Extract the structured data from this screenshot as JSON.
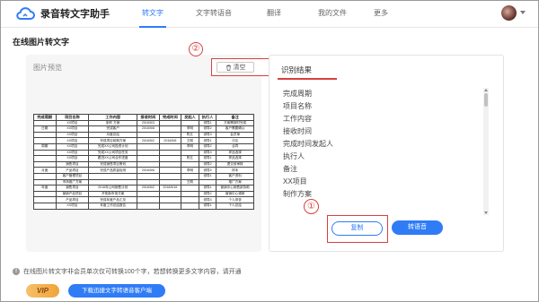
{
  "app": {
    "title": "录音转文字助手"
  },
  "nav": {
    "items": [
      {
        "label": "转文字",
        "active": true
      },
      {
        "label": "文字转语音",
        "active": false
      },
      {
        "label": "翻译",
        "active": false
      },
      {
        "label": "我的文件",
        "active": false
      },
      {
        "label": "更多",
        "active": false
      }
    ]
  },
  "page": {
    "title": "在线图片转文字"
  },
  "preview": {
    "label": "图片预览",
    "clear_label": "清空",
    "marker": "②",
    "document": {
      "headers": [
        "完成周期",
        "项目名称",
        "工作内容",
        "接收时间",
        "完成时间",
        "发起人",
        "执行人",
        "备注"
      ],
      "rows": [
        [
          "",
          "XX项目",
          "制作 方案",
          "2016/5/3",
          "",
          "",
          "领导1",
          "方案需按时完成"
        ],
        [
          "日期",
          "XX项目",
          "完成客户",
          "2016/5/8",
          "",
          "李明",
          "领导2",
          "客户需要确认"
        ],
        [
          "",
          "XX项目",
          "月度总结",
          "",
          "",
          "陈五",
          "领导3",
          "会员单"
        ],
        [
          "",
          "XX项目",
          "完成项目前期方案",
          "2016/5/2",
          "2016/5/6",
          "王刚",
          "领导1",
          "讨论"
        ],
        [
          "周期",
          "XX项目",
          "完成XX公司投资计划",
          "",
          "",
          "李明",
          "领导2",
          "合同"
        ],
        [
          "",
          "XX项目",
          "完成XX公司项目任务",
          "",
          "",
          "",
          "领导3",
          "样品选择"
        ],
        [
          "",
          "XX项目",
          "跟进XX公司合作进度",
          "",
          "",
          "陈五",
          "领导1",
          "样品选择"
        ],
        [
          "",
          "销售项目",
          "完成销售项目策划",
          "",
          "",
          "",
          "领导2",
          "提交前审核"
        ],
        [
          "月度",
          "产品项目",
          "完成产品质量检测",
          "2016/5/6",
          "",
          "李明",
          "领导3",
          "样本"
        ],
        [
          "",
          "客户管理项目",
          "",
          "",
          "",
          "",
          "领导1",
          "客户资料"
        ],
        [
          "",
          "市场推广方案",
          "",
          "",
          "",
          "王刚",
          "",
          "推广方案"
        ],
        [
          "年度",
          "销售项目",
          "2016年公司销售计划",
          "2016/5/2",
          "2016/5/16",
          "",
          "领导1",
          "营销中心销售部协助"
        ],
        [
          "",
          "营销产品项目",
          "开拓新市场方案",
          "",
          "",
          "",
          "领导2",
          "营销中心调研"
        ],
        [
          "",
          "产品项目",
          "完成年度产品汇总",
          "",
          "",
          "",
          "领导3",
          "个人排查"
        ],
        [
          "",
          "XX项目",
          "年度工作总结报告",
          "",
          "",
          "",
          "领导1",
          "个人总结"
        ]
      ]
    }
  },
  "result": {
    "title": "识别结果",
    "items": [
      "完成周期",
      "项目名称",
      "工作内容",
      "接收时间",
      "完成时间发起人",
      "执行人",
      "备注",
      "XX项目",
      "制作方案"
    ],
    "copy_label": "复制",
    "voice_label": "转语音",
    "marker": "①"
  },
  "footer": {
    "info_text": "在线图片转文字非会员单次仅可转换100个字，若想转换更多文字内容，请开通",
    "vip_label": "VIP",
    "download_label": "下载迅捷文字转语音客户端"
  },
  "colors": {
    "accent": "#2f7cf6",
    "highlight": "#d84040"
  }
}
